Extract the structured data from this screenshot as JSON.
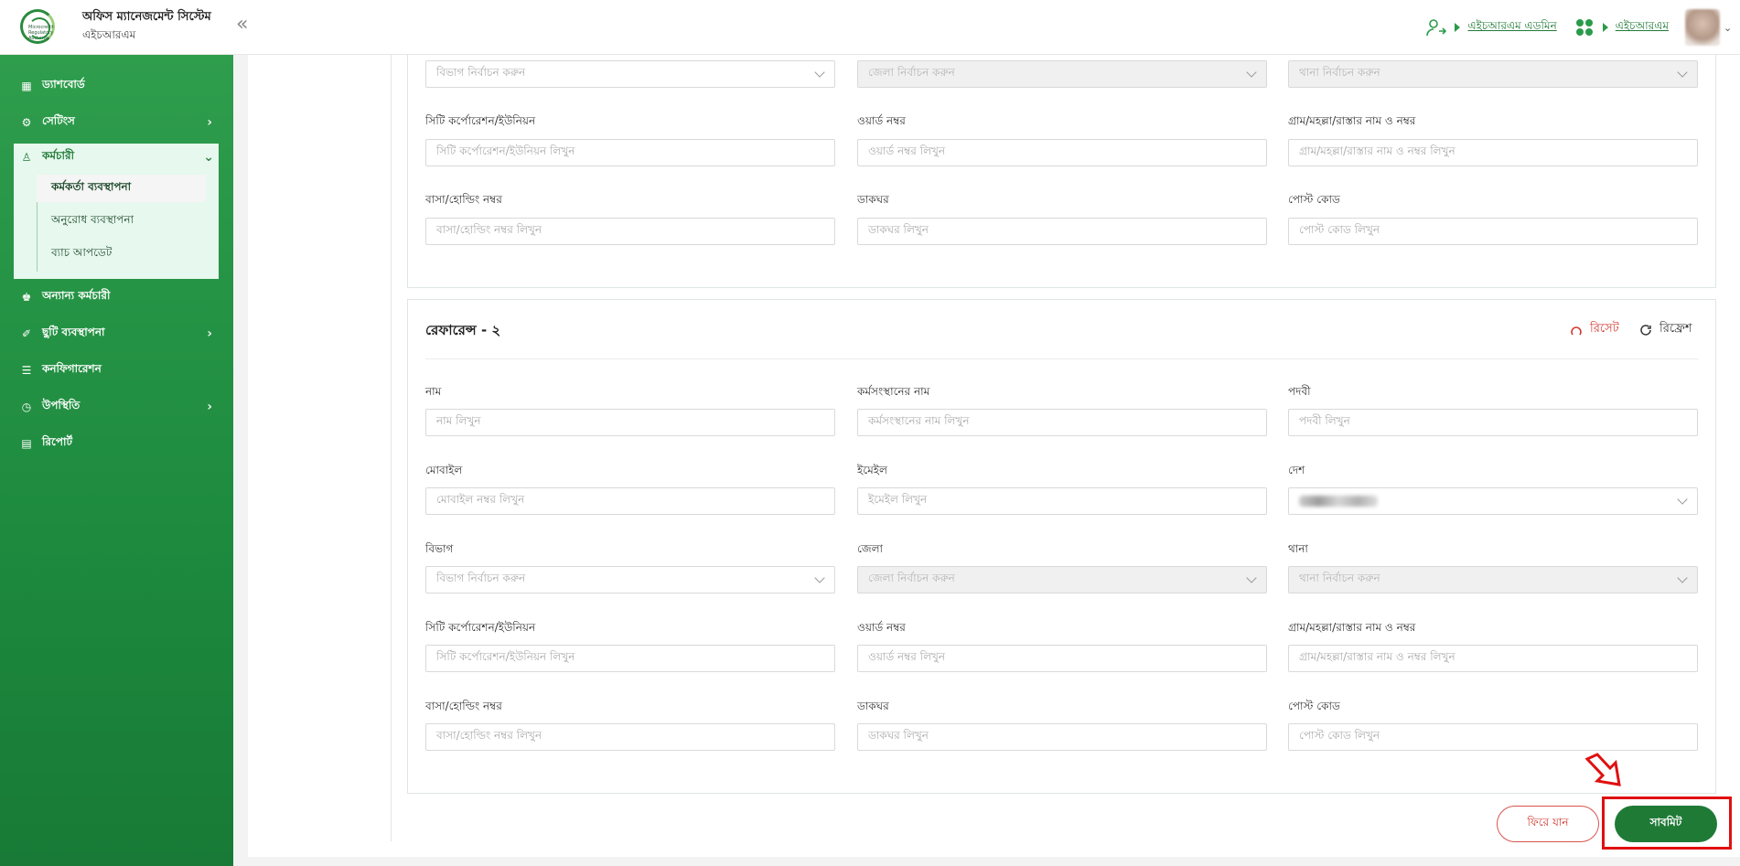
{
  "header": {
    "app_title": "অফিস ম্যানেজমেন্ট সিস্টেম",
    "app_subtitle": "এইচআরএম",
    "user_role": "এইচআরএম এডমিন",
    "module": "এইচআরএম",
    "logo_text": [
      "Microcredit",
      "Regulatory",
      "Authority"
    ]
  },
  "sidebar": {
    "items": [
      {
        "label": "ড্যাশবোর্ড",
        "icon": "dashboard-icon"
      },
      {
        "label": "সেটিংস",
        "icon": "gear-icon"
      },
      {
        "label": "কর্মচারী",
        "icon": "user-icon"
      },
      {
        "label": "অন্যান্য কর্মচারী",
        "icon": "users-icon"
      },
      {
        "label": "ছুটি ব্যবস্থাপনা",
        "icon": "leave-icon"
      },
      {
        "label": "কনফিগারেশন",
        "icon": "sliders-icon"
      },
      {
        "label": "উপস্থিতি",
        "icon": "clock-icon"
      },
      {
        "label": "রিপোর্ট",
        "icon": "document-icon"
      }
    ],
    "employee_submenu": [
      {
        "label": "কর্মকর্তা ব্যবস্থাপনা"
      },
      {
        "label": "অনুরোধ ব্যবস্থাপনা"
      },
      {
        "label": "ব্যাচ আপডেট"
      }
    ]
  },
  "ref1": {
    "division_ph": "বিভাগ নির্বাচন করুন",
    "district_ph": "জেলা নির্বাচন করুন",
    "thana_ph": "থানা নির্বাচন করুন",
    "city_label": "সিটি কর্পোরেশন/ইউনিয়ন",
    "city_ph": "সিটি কর্পোরেশন/ইউনিয়ন লিখুন",
    "ward_label": "ওয়ার্ড নম্বর",
    "ward_ph": "ওয়ার্ড নম্বর লিখুন",
    "village_label": "গ্রাম/মহল্লা/রাস্তার নাম ও নম্বর",
    "village_ph": "গ্রাম/মহল্লা/রাস্তার নাম ও নম্বর লিখুন",
    "house_label": "বাসা/হোল্ডিং নম্বর",
    "house_ph": "বাসা/হোল্ডিং নম্বর লিখুন",
    "post_office_label": "ডাকঘর",
    "post_office_ph": "ডাকঘর লিখুন",
    "postcode_label": "পোস্ট কোড",
    "postcode_ph": "পোস্ট কোড লিখুন"
  },
  "ref2": {
    "title": "রেফারেন্স - ২",
    "reset_label": "রিসেট",
    "refresh_label": "রিফ্রেশ",
    "name_label": "নাম",
    "name_ph": "নাম লিখুন",
    "org_label": "কর্মসংস্থানের নাম",
    "org_ph": "কর্মসংস্থানের নাম লিখুন",
    "designation_label": "পদবী",
    "designation_ph": "পদবী লিখুন",
    "mobile_label": "মোবাইল",
    "mobile_ph": "মোবাইল নম্বর লিখুন",
    "email_label": "ইমেইল",
    "email_ph": "ইমেইল লিখুন",
    "country_label": "দেশ",
    "division_label": "বিভাগ",
    "division_ph": "বিভাগ নির্বাচন করুন",
    "district_label": "জেলা",
    "district_ph": "জেলা নির্বাচন করুন",
    "thana_label": "থানা",
    "thana_ph": "থানা নির্বাচন করুন",
    "city_label": "সিটি কর্পোরেশন/ইউনিয়ন",
    "city_ph": "সিটি কর্পোরেশন/ইউনিয়ন লিখুন",
    "ward_label": "ওয়ার্ড নম্বর",
    "ward_ph": "ওয়ার্ড নম্বর লিখুন",
    "village_label": "গ্রাম/মহল্লা/রাস্তার নাম ও নম্বর",
    "village_ph": "গ্রাম/মহল্লা/রাস্তার নাম ও নম্বর লিখুন",
    "house_label": "বাসা/হোল্ডিং নম্বর",
    "house_ph": "বাসা/হোল্ডিং নম্বর লিখুন",
    "post_office_label": "ডাকঘর",
    "post_office_ph": "ডাকঘর লিখুন",
    "postcode_label": "পোস্ট কোড",
    "postcode_ph": "পোস্ট কোড লিখুন"
  },
  "actions": {
    "back_label": "ফিরে যান",
    "submit_label": "সাবমিট"
  },
  "colors": {
    "brand_green": "#1f7a36",
    "sidebar_green": "#2e9d4c",
    "reset_red": "#d0342c",
    "highlight_red": "#e01010"
  }
}
